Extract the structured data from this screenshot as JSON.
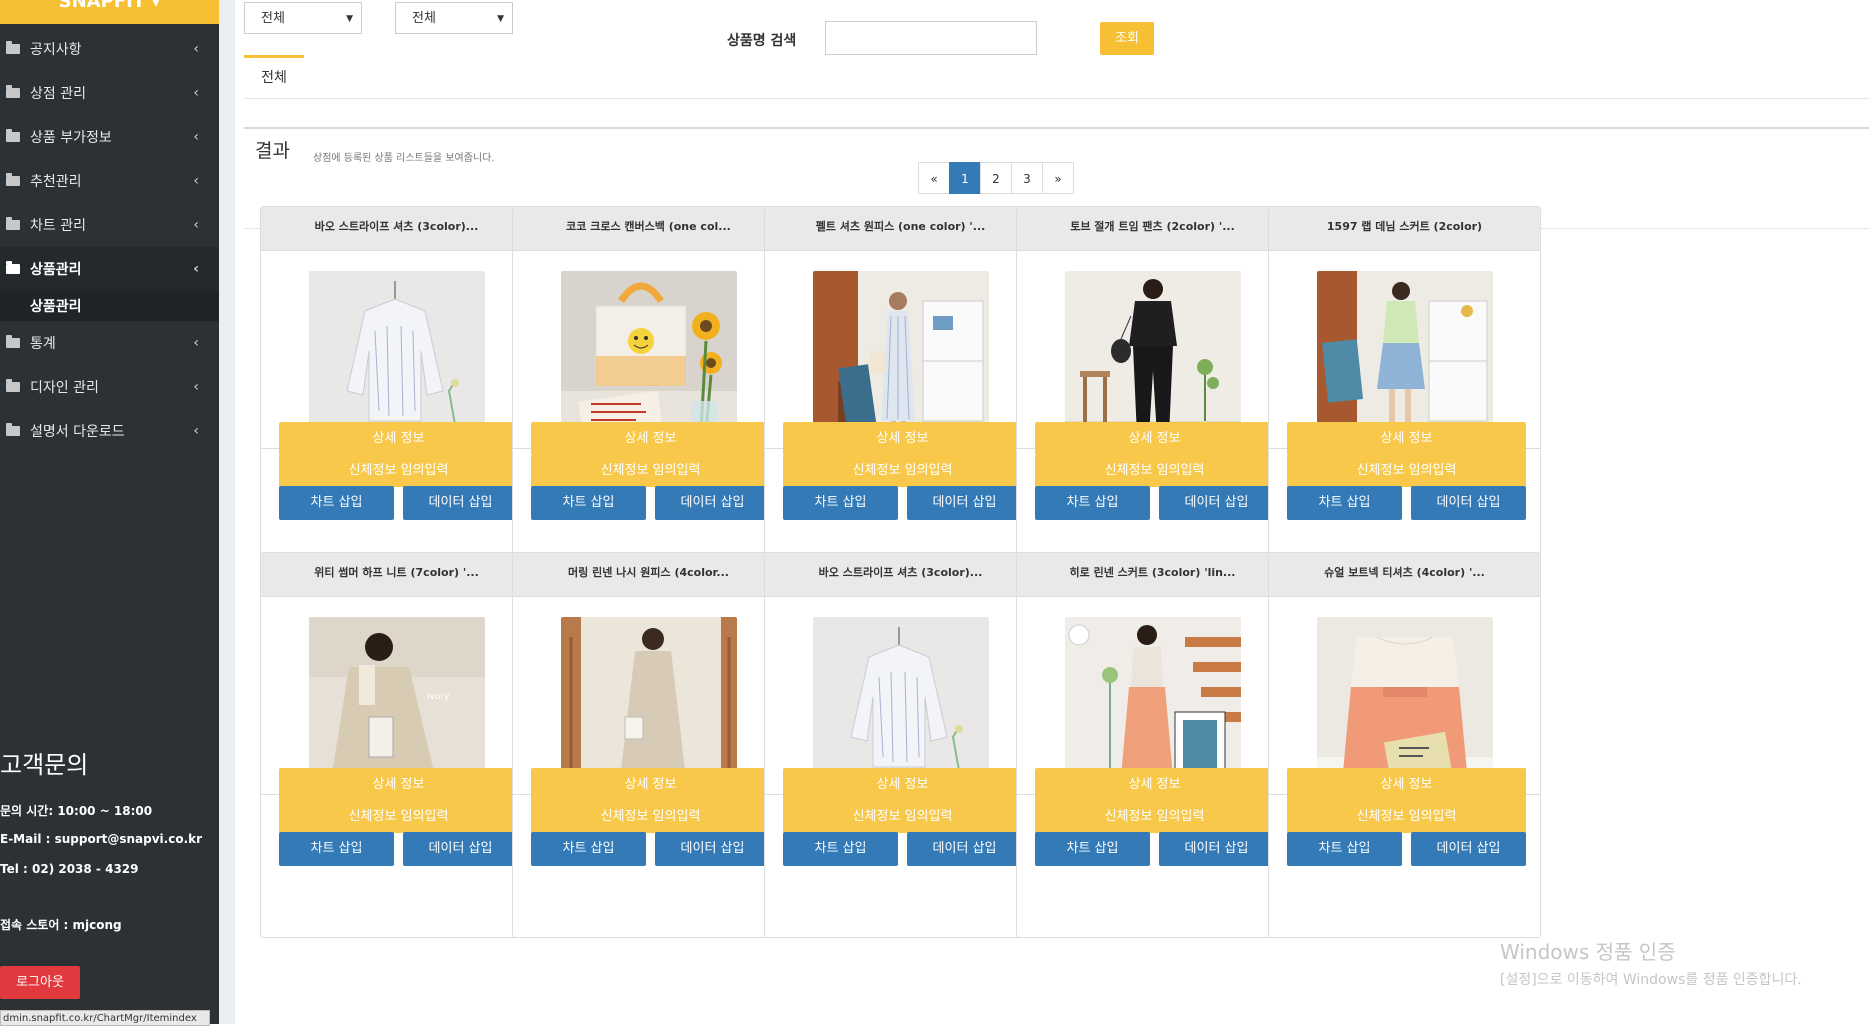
{
  "sidebar": {
    "brand": "SNAPFIT ▾",
    "menu": [
      {
        "label": "공지사항",
        "active": false
      },
      {
        "label": "상점 관리",
        "active": false
      },
      {
        "label": "상품 부가정보",
        "active": false
      },
      {
        "label": "추천관리",
        "active": false
      },
      {
        "label": "차트 관리",
        "active": false
      },
      {
        "label": "상품관리",
        "active": true,
        "sub": "상품관리"
      },
      {
        "label": "통계",
        "active": false
      },
      {
        "label": "디자인 관리",
        "active": false
      },
      {
        "label": "설명서 다운로드",
        "active": false
      }
    ],
    "cs": {
      "title": "고객문의",
      "hours": "문의 시간: 10:00 ~ 18:00",
      "email": "E-Mail : support@snapvi.co.kr",
      "tel": "Tel : 02) 2038 - 4329",
      "store": "접속 스토어 : mjcong"
    },
    "logout_label": "로그아웃",
    "status_url": "dmin.snapfit.co.kr/ChartMgr/Itemindex"
  },
  "filters": {
    "select1": "전체",
    "select2": "전체",
    "search_label": "상품명 검색",
    "search_value": "",
    "query_label": "조회"
  },
  "tab": {
    "label": "전체"
  },
  "result": {
    "title": "결과",
    "desc": "상점에 등록된 상품 리스트들을 보여줍니다.",
    "pages": [
      "«",
      "1",
      "2",
      "3",
      "»"
    ],
    "current_page": "1"
  },
  "card_buttons": {
    "detail": "상세 정보",
    "body_info": "신체정보 임의입력",
    "chart_insert": "차트 삽입",
    "data_insert": "데이터 삽입"
  },
  "products": [
    {
      "name": "바오 스트라이프 셔츠 (3color)...",
      "scene": "shirt-white-wall"
    },
    {
      "name": "코코 크로스 캔버스백 (one col...",
      "scene": "canvas-bag-sunflower"
    },
    {
      "name": "펠트 셔츠 원피스 (one color) '...",
      "scene": "shirt-dress-shelf"
    },
    {
      "name": "토브 절개 트임 팬츠 (2color) '...",
      "scene": "black-outfit-stool"
    },
    {
      "name": "1597 랩 데님 스커트 (2color)",
      "scene": "denim-skirt-shelf"
    },
    {
      "name": "위티 썸머 하프 니트 (7color) '...",
      "scene": "beige-knit-mirror"
    },
    {
      "name": "머링 린넨 나시 원피스 (4color...",
      "scene": "linen-dress-mirror"
    },
    {
      "name": "바오 스트라이프 셔츠 (3color)...",
      "scene": "shirt-white-wall"
    },
    {
      "name": "히로 린넨 스커트 (3color) 'lin...",
      "scene": "orange-skirt-stairs"
    },
    {
      "name": "슈얼 보트넥 티셔츠 (4color) '...",
      "scene": "boatneck-tee-book"
    }
  ],
  "watermark": {
    "line1": "Windows 정품 인증",
    "line2": "[설정]으로 이동하여 Windows를 정품 인증합니다."
  },
  "colors": {
    "accent_yellow": "#f7c034",
    "button_blue": "#337ab7",
    "sidebar_bg": "#2b3135",
    "logout_red": "#e0393e"
  }
}
